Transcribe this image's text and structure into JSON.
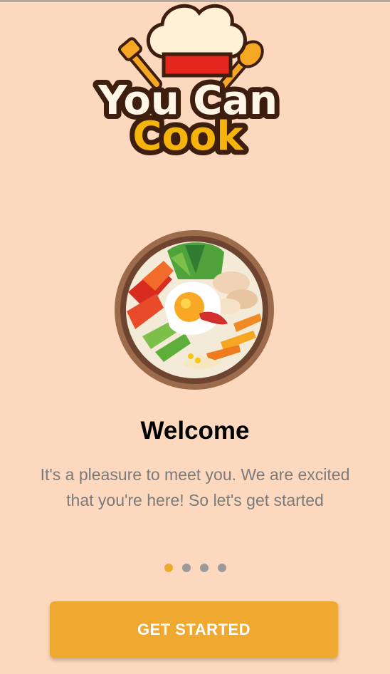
{
  "logo": {
    "line1": "You Can",
    "line2": "Cook"
  },
  "onboarding": {
    "title": "Welcome",
    "subtitle_line1": "It's a pleasure to meet you. We are excited",
    "subtitle_line2": "that you're here! So let's get started",
    "pages_total": 4,
    "current_page": 1
  },
  "cta": {
    "label": "GET STARTED"
  },
  "colors": {
    "background": "#FCD9BE",
    "accent": "#EFA830",
    "dot_inactive": "#9A9A9A"
  },
  "icons": {
    "logo": "chef-hat-logo",
    "illustration": "bibimbap-bowl"
  }
}
